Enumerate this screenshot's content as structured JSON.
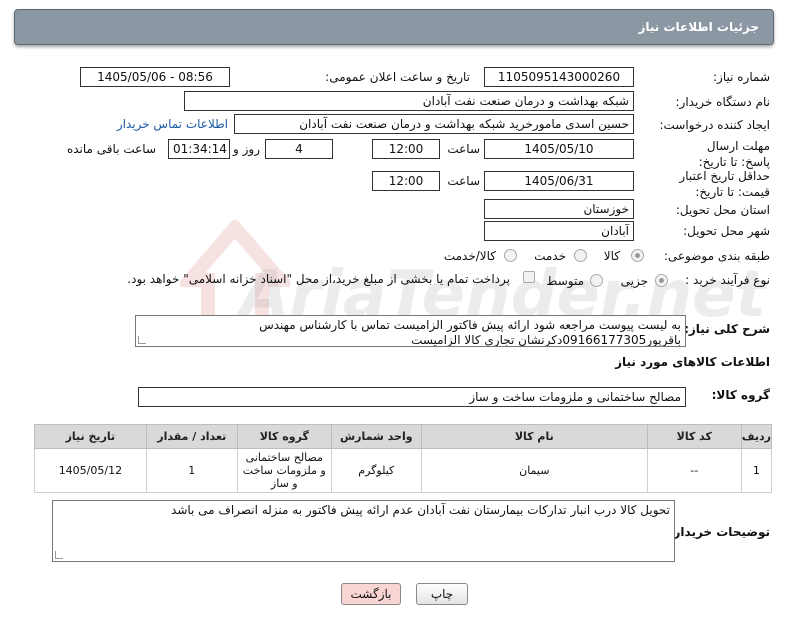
{
  "header": {
    "title": "جزئیات اطلاعات نیاز"
  },
  "watermark": {
    "text": "AriaTender.net"
  },
  "need_number": {
    "label": "شماره نیاز:",
    "value": "1105095143000260"
  },
  "announce": {
    "label": "تاریخ و ساعت اعلان عمومی:",
    "value": "1405/05/06 - 08:56"
  },
  "buyer_org": {
    "label": "نام دستگاه خریدار:",
    "value": "شبکه بهداشت و درمان صنعت نفت آبادان"
  },
  "requester": {
    "label": "ایجاد کننده درخواست:",
    "value": "حسین اسدی مامورخرید شبکه بهداشت و درمان صنعت نفت آبادان",
    "contact_link": "اطلاعات تماس خریدار"
  },
  "deadline": {
    "label": "مهلت ارسال پاسخ: تا تاریخ:",
    "date": "1405/05/10",
    "time_label": "ساعت",
    "time": "12:00",
    "days": "4",
    "days_label": "روز و",
    "remaining": "01:34:14",
    "remaining_label": "ساعت باقی مانده"
  },
  "price_validity": {
    "label": "حداقل تاریخ اعتبار قیمت: تا تاریخ:",
    "date": "1405/06/31",
    "time_label": "ساعت",
    "time": "12:00"
  },
  "province": {
    "label": "استان محل تحویل:",
    "value": "خوزستان"
  },
  "city": {
    "label": "شهر محل تحویل:",
    "value": "آبادان"
  },
  "category": {
    "label": "طبقه بندی موضوعی:",
    "options": [
      "کالا",
      "خدمت",
      "کالا/خدمت"
    ],
    "selected": "کالا"
  },
  "process": {
    "label": "نوع فرآیند خرید :",
    "options": [
      "جزیی",
      "متوسط"
    ],
    "selected": "جزیی",
    "payment_note": "پرداخت تمام یا بخشی از مبلغ خرید،از محل \"اسناد خزانه اسلامی\" خواهد بود."
  },
  "description": {
    "label": "شرح کلی نیاز:",
    "line1": "به لیست پیوست مراجعه شود ارائه پیش فاکتور الزامیست تماس با کارشناس  مهندس",
    "line2": "باقرپور09166177305دکرنشان تجاری کالا الزامیست"
  },
  "goods_info": {
    "title": "اطلاعات کالاهای مورد نیاز"
  },
  "goods_group": {
    "label": "گروه کالا:",
    "value": "مصالح ساختمانی و ملزومات ساخت و ساز"
  },
  "table": {
    "headers": [
      "ردیف",
      "کد کالا",
      "نام کالا",
      "واحد شمارش",
      "گروه کالا",
      "تعداد / مقدار",
      "تاریخ نیاز"
    ],
    "rows": [
      [
        "1",
        "--",
        "سیمان",
        "کیلوگرم",
        "مصالح ساختمانی و ملزومات ساخت و ساز",
        "1",
        "1405/05/12"
      ]
    ]
  },
  "buyer_notes": {
    "label": "توضیحات خریدار:",
    "value": "تحویل کالا درب انبار تدارکات بیمارستان نفت آبادان عدم ارائه پیش فاکتور به منزله انصراف می باشد"
  },
  "buttons": {
    "print": "چاپ",
    "back": "بازگشت"
  }
}
